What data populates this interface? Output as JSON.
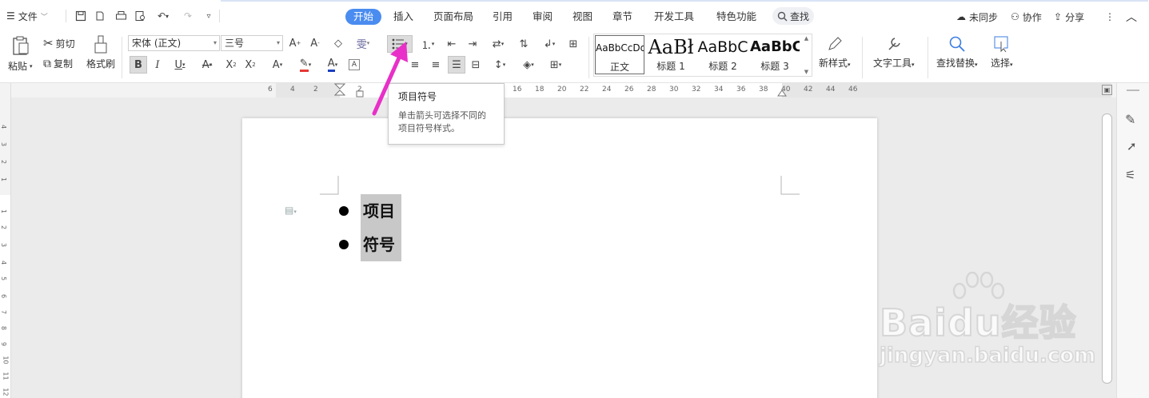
{
  "topbar": {
    "menu_label": "文件",
    "tabs": [
      {
        "label": "开始",
        "active": true
      },
      {
        "label": "插入"
      },
      {
        "label": "页面布局"
      },
      {
        "label": "引用"
      },
      {
        "label": "审阅"
      },
      {
        "label": "视图"
      },
      {
        "label": "章节"
      },
      {
        "label": "开发工具"
      },
      {
        "label": "特色功能"
      }
    ],
    "search_label": "查找",
    "sync_label": "未同步",
    "collab_label": "协作",
    "share_label": "分享",
    "accent_color": "#4a8cf0"
  },
  "ribbon": {
    "paste_label": "粘贴",
    "cut_label": "剪切",
    "copy_label": "复制",
    "format_painter_label": "格式刷",
    "font_family": "宋体 (正文)",
    "font_size": "三号",
    "styles": [
      {
        "preview": "AaBbCcDd",
        "label": "正文"
      },
      {
        "preview": "AaBł",
        "label": "标题 1"
      },
      {
        "preview": "AaBbC",
        "label": "标题 2"
      },
      {
        "preview": "AaBbC",
        "label": "标题 3"
      }
    ],
    "new_style_label": "新样式",
    "text_tools_label": "文字工具",
    "find_replace_label": "查找替换",
    "select_label": "选择"
  },
  "ruler": {
    "numbers": [
      "6",
      "4",
      "2",
      "2",
      "16",
      "18",
      "20",
      "22",
      "24",
      "26",
      "28",
      "30",
      "32",
      "34",
      "36",
      "38",
      "40",
      "42",
      "44",
      "46"
    ]
  },
  "vruler": {
    "numbers": [
      "4",
      "3",
      "2",
      "1",
      "1",
      "2",
      "3",
      "4",
      "5",
      "6",
      "7",
      "8",
      "9",
      "10",
      "11",
      "12"
    ]
  },
  "tooltip": {
    "title": "项目符号",
    "line1": "单击箭头可选择不同的",
    "line2": "项目符号样式。"
  },
  "document": {
    "bullets": [
      "项目",
      "符号"
    ],
    "highlight_color": "#c8c8c8"
  },
  "watermark": {
    "brand": "Baidu经验",
    "url": "jingyan.baidu.com"
  }
}
